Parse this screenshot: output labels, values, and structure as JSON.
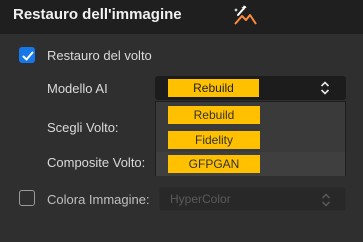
{
  "header": {
    "title": "Restauro dell'immagine",
    "icon": "magic-wand-mountain-icon"
  },
  "face_restore": {
    "label": "Restauro del volto",
    "checked": true
  },
  "ai_model": {
    "label": "Modello AI",
    "selected": "Rebuild",
    "options": [
      "Rebuild",
      "Fidelity",
      "GFPGAN"
    ]
  },
  "choose_face": {
    "label": "Scegli Volto:"
  },
  "composite_face": {
    "label": "Composite Volto:"
  },
  "colorize": {
    "label": "Colora Immagine:",
    "checked": false,
    "value": "HyperColor",
    "enabled": false
  },
  "colors": {
    "accent": "#1677e8",
    "pill": "#ffc000",
    "background": "#2f2f2f"
  }
}
